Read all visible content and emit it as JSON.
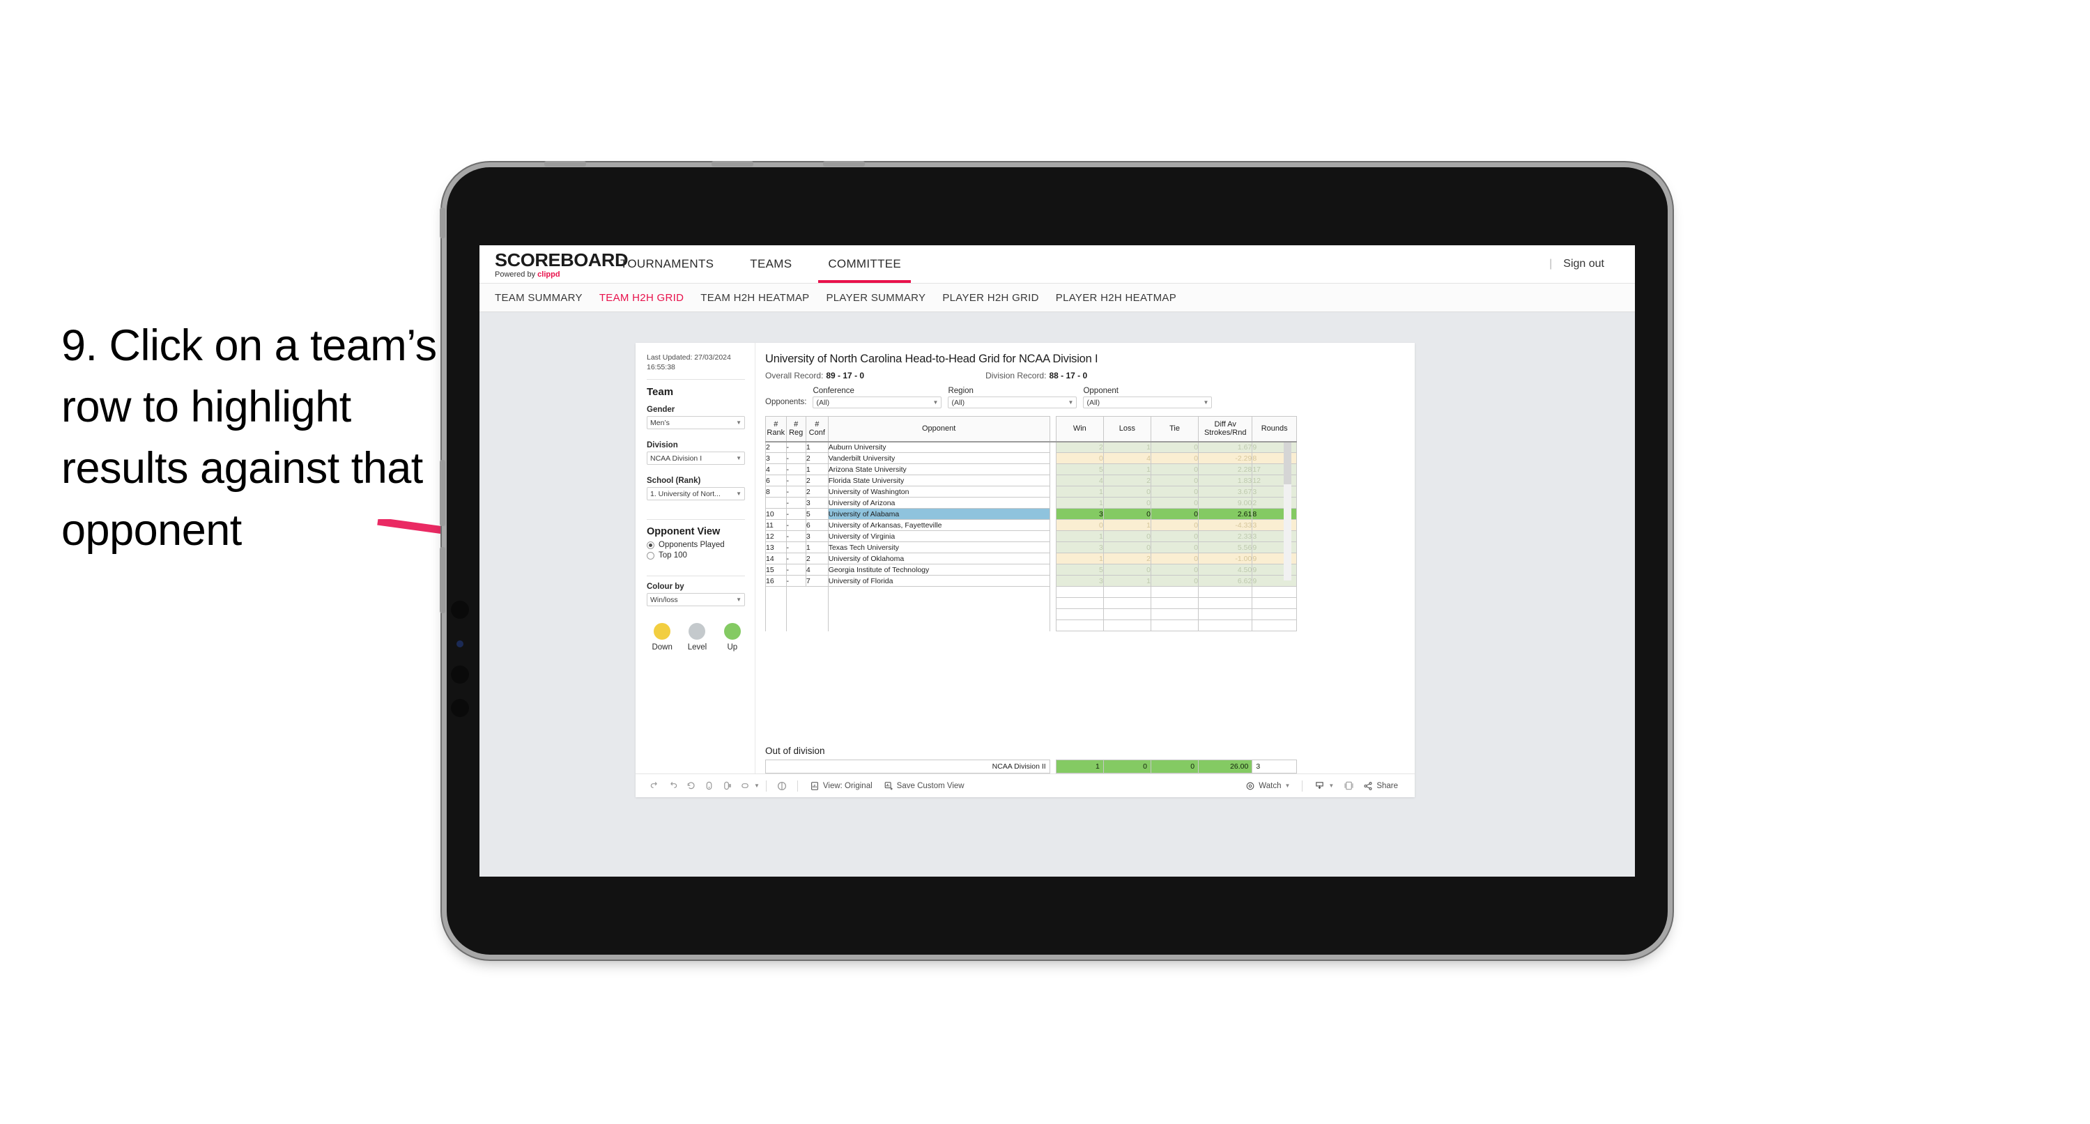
{
  "annotation": {
    "text": "9. Click on a team’s row to highlight results against that opponent",
    "arrow_color": "#ea2a63"
  },
  "topnav": {
    "brand_name": "SCOREBOARD",
    "brand_sub_prefix": "Powered by",
    "brand_sub_name": "clippd",
    "items": [
      {
        "label": "TOURNAMENTS",
        "active": false
      },
      {
        "label": "TEAMS",
        "active": false
      },
      {
        "label": "COMMITTEE",
        "active": true
      }
    ],
    "divider": "|",
    "sign_out": "Sign out"
  },
  "subnav": {
    "items": [
      {
        "label": "TEAM SUMMARY",
        "active": false
      },
      {
        "label": "TEAM H2H GRID",
        "active": true
      },
      {
        "label": "TEAM H2H HEATMAP",
        "active": false
      },
      {
        "label": "PLAYER SUMMARY",
        "active": false
      },
      {
        "label": "PLAYER H2H GRID",
        "active": false
      },
      {
        "label": "PLAYER H2H HEATMAP",
        "active": false
      }
    ]
  },
  "panel": {
    "last_updated_label": "Last Updated: 27/03/2024",
    "last_updated_time": "16:55:38",
    "team_heading": "Team",
    "gender_label": "Gender",
    "gender_value": "Men’s",
    "division_label": "Division",
    "division_value": "NCAA Division I",
    "school_label": "School (Rank)",
    "school_value": "1. University of Nort...",
    "opponent_view_heading": "Opponent View",
    "opponent_view_options": [
      {
        "label": "Opponents Played",
        "selected": true
      },
      {
        "label": "Top 100",
        "selected": false
      }
    ],
    "colour_by_label": "Colour by",
    "colour_by_value": "Win/loss",
    "legend": [
      {
        "label": "Down",
        "color": "#f2ce40"
      },
      {
        "label": "Level",
        "color": "#c4c9cc"
      },
      {
        "label": "Up",
        "color": "#84ca63"
      }
    ]
  },
  "viz": {
    "title": "University of North Carolina Head-to-Head Grid for NCAA Division I",
    "overall_record_label": "Overall Record:",
    "overall_record_value": "89 - 17 - 0",
    "division_record_label": "Division Record:",
    "division_record_value": "88 - 17 - 0",
    "opponents_label": "Opponents:",
    "filters": [
      {
        "caption": "Conference",
        "value": "(All)"
      },
      {
        "caption": "Region",
        "value": "(All)"
      },
      {
        "caption": "Opponent",
        "value": "(All)"
      }
    ],
    "columns": [
      {
        "line1": "#",
        "line2": "Rank"
      },
      {
        "line1": "#",
        "line2": "Reg"
      },
      {
        "line1": "#",
        "line2": "Conf"
      },
      {
        "line1": "Opponent",
        "line2": ""
      },
      {
        "line1": "Win",
        "line2": ""
      },
      {
        "line1": "Loss",
        "line2": ""
      },
      {
        "line1": "Tie",
        "line2": ""
      },
      {
        "line1": "Diff Av",
        "line2": "Strokes/Rnd"
      },
      {
        "line1": "Rounds",
        "line2": ""
      }
    ],
    "rows": [
      {
        "rank": "2",
        "reg": "-",
        "conf": "1",
        "opponent": "Auburn University",
        "win": "2",
        "loss": "1",
        "tie": "0",
        "diff": "1.67",
        "rounds": "9",
        "state": "win"
      },
      {
        "rank": "3",
        "reg": "-",
        "conf": "2",
        "opponent": "Vanderbilt University",
        "win": "0",
        "loss": "4",
        "tie": "0",
        "diff": "-2.29",
        "rounds": "8",
        "state": "loss"
      },
      {
        "rank": "4",
        "reg": "-",
        "conf": "1",
        "opponent": "Arizona State University",
        "win": "5",
        "loss": "1",
        "tie": "0",
        "diff": "2.28",
        "rounds": "17",
        "state": "win"
      },
      {
        "rank": "6",
        "reg": "-",
        "conf": "2",
        "opponent": "Florida State University",
        "win": "4",
        "loss": "2",
        "tie": "0",
        "diff": "1.83",
        "rounds": "12",
        "state": "win"
      },
      {
        "rank": "8",
        "reg": "-",
        "conf": "2",
        "opponent": "University of Washington",
        "win": "1",
        "loss": "0",
        "tie": "0",
        "diff": "3.67",
        "rounds": "3",
        "state": "win"
      },
      {
        "rank": "",
        "reg": "-",
        "conf": "3",
        "opponent": "University of Arizona",
        "win": "1",
        "loss": "0",
        "tie": "0",
        "diff": "9.00",
        "rounds": "2",
        "state": "win"
      },
      {
        "rank": "10",
        "reg": "-",
        "conf": "5",
        "opponent": "University of Alabama",
        "win": "3",
        "loss": "0",
        "tie": "0",
        "diff": "2.61",
        "rounds": "8",
        "state": "selected"
      },
      {
        "rank": "11",
        "reg": "-",
        "conf": "6",
        "opponent": "University of Arkansas, Fayetteville",
        "win": "0",
        "loss": "1",
        "tie": "0",
        "diff": "-4.33",
        "rounds": "3",
        "state": "loss"
      },
      {
        "rank": "12",
        "reg": "-",
        "conf": "3",
        "opponent": "University of Virginia",
        "win": "1",
        "loss": "0",
        "tie": "0",
        "diff": "2.33",
        "rounds": "3",
        "state": "win"
      },
      {
        "rank": "13",
        "reg": "-",
        "conf": "1",
        "opponent": "Texas Tech University",
        "win": "3",
        "loss": "0",
        "tie": "0",
        "diff": "5.56",
        "rounds": "9",
        "state": "win"
      },
      {
        "rank": "14",
        "reg": "-",
        "conf": "2",
        "opponent": "University of Oklahoma",
        "win": "1",
        "loss": "2",
        "tie": "0",
        "diff": "-1.00",
        "rounds": "9",
        "state": "loss"
      },
      {
        "rank": "15",
        "reg": "-",
        "conf": "4",
        "opponent": "Georgia Institute of Technology",
        "win": "5",
        "loss": "0",
        "tie": "0",
        "diff": "4.50",
        "rounds": "9",
        "state": "win"
      },
      {
        "rank": "16",
        "reg": "-",
        "conf": "7",
        "opponent": "University of Florida",
        "win": "3",
        "loss": "1",
        "tie": "0",
        "diff": "6.62",
        "rounds": "9",
        "state": "win"
      }
    ],
    "out_of_division": {
      "caption": "Out of division",
      "row": {
        "name": "NCAA Division II",
        "win": "1",
        "loss": "0",
        "tie": "0",
        "diff": "26.00",
        "rounds": "3"
      }
    }
  },
  "toolbar": {
    "view_label": "View: Original",
    "save_label": "Save Custom View",
    "watch_label": "Watch",
    "share_label": "Share"
  }
}
